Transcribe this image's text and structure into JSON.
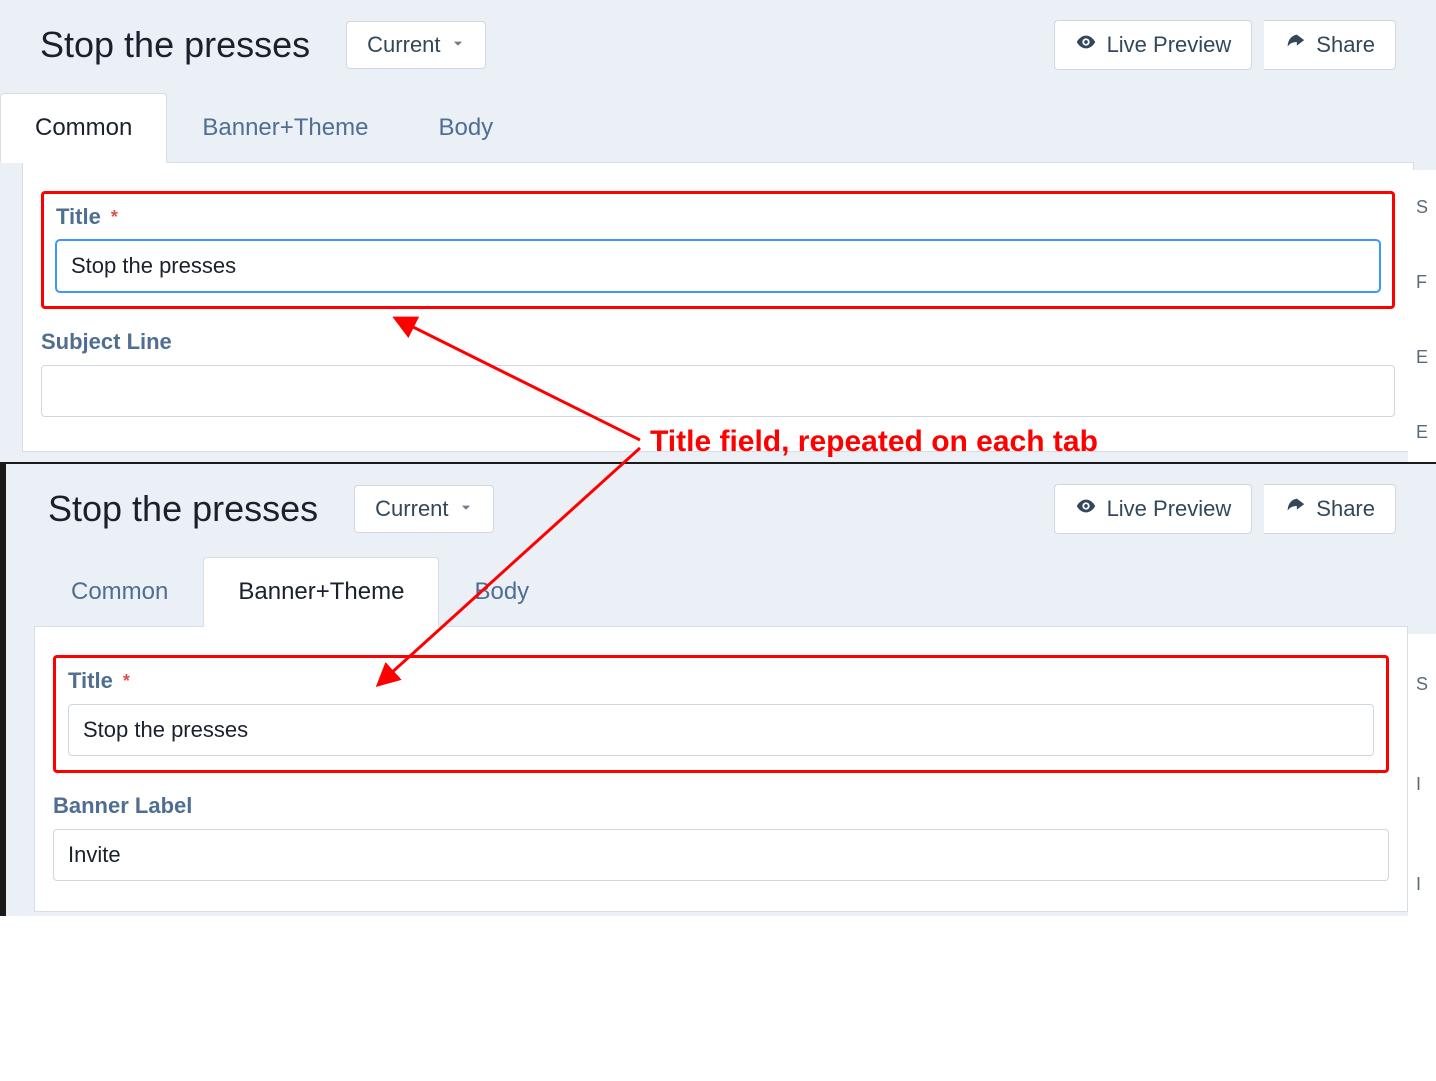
{
  "annotation": {
    "text": "Title field, repeated on each tab"
  },
  "shot1": {
    "page_title": "Stop the presses",
    "version_btn": "Current",
    "live_preview": "Live Preview",
    "share": "Share",
    "tabs": {
      "common": "Common",
      "banner": "Banner+Theme",
      "body": "Body"
    },
    "fields": {
      "title_label": "Title",
      "title_value": "Stop the presses",
      "subject_label": "Subject Line",
      "subject_value": ""
    }
  },
  "shot2": {
    "page_title": "Stop the presses",
    "version_btn": "Current",
    "live_preview": "Live Preview",
    "share": "Share",
    "tabs": {
      "common": "Common",
      "banner": "Banner+Theme",
      "body": "Body"
    },
    "fields": {
      "title_label": "Title",
      "title_value": "Stop the presses",
      "banner_label": "Banner Label",
      "banner_value": "Invite"
    }
  },
  "required_mark": "*"
}
